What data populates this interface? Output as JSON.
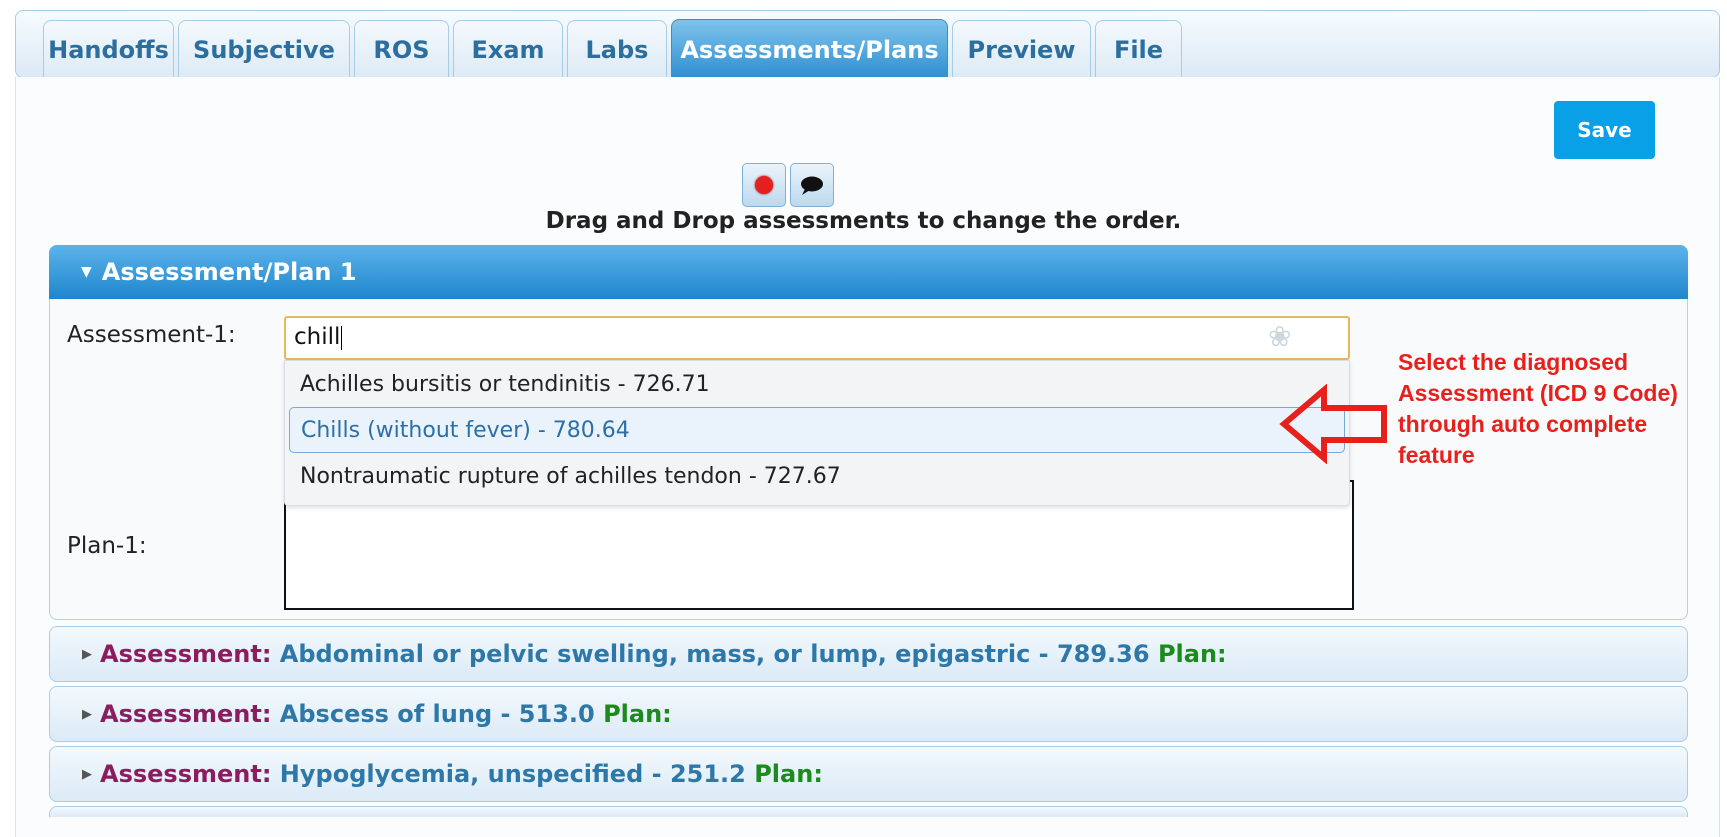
{
  "tabs": [
    {
      "label": "Handoffs"
    },
    {
      "label": "Subjective"
    },
    {
      "label": "ROS"
    },
    {
      "label": "Exam"
    },
    {
      "label": "Labs"
    },
    {
      "label": "Assessments/Plans"
    },
    {
      "label": "Preview"
    },
    {
      "label": "File"
    }
  ],
  "active_tab": "Assessments/Plans",
  "save_label": "Save",
  "icons": {
    "record": "record-icon",
    "comment": "speech-bubble-icon",
    "voice": "voice-input-icon"
  },
  "drag_hint": "Drag and Drop assessments to change the order.",
  "panel1": {
    "title": "Assessment/Plan 1",
    "assessment_label": "Assessment-1:",
    "assessment_value": "chill",
    "plan_label": "Plan-1:",
    "plan_value": ""
  },
  "autocomplete": [
    {
      "text": "Achilles bursitis or tendinitis - 726.71"
    },
    {
      "text": "Chills (without fever) - 780.64"
    },
    {
      "text": "Nontraumatic rupture of achilles tendon - 727.67"
    }
  ],
  "annotation": {
    "lines": [
      "Select the diagnosed",
      "Assessment (ICD 9 Code)",
      "through auto complete",
      "feature"
    ],
    "color": "#e8201c"
  },
  "rows": [
    {
      "assessment_key": "Assessment:",
      "assessment": "Abdominal or pelvic swelling, mass, or lump, epigastric - 789.36",
      "plan_key": "Plan:"
    },
    {
      "assessment_key": "Assessment:",
      "assessment": "Abscess of lung - 513.0",
      "plan_key": "Plan:"
    },
    {
      "assessment_key": "Assessment:",
      "assessment": "Hypoglycemia, unspecified - 251.2",
      "plan_key": "Plan:"
    }
  ],
  "colors": {
    "accent": "#2d8fd0",
    "save": "#0aa0e8",
    "assessment_key": "#8a1d5f",
    "plan_key": "#1d8a1d"
  }
}
